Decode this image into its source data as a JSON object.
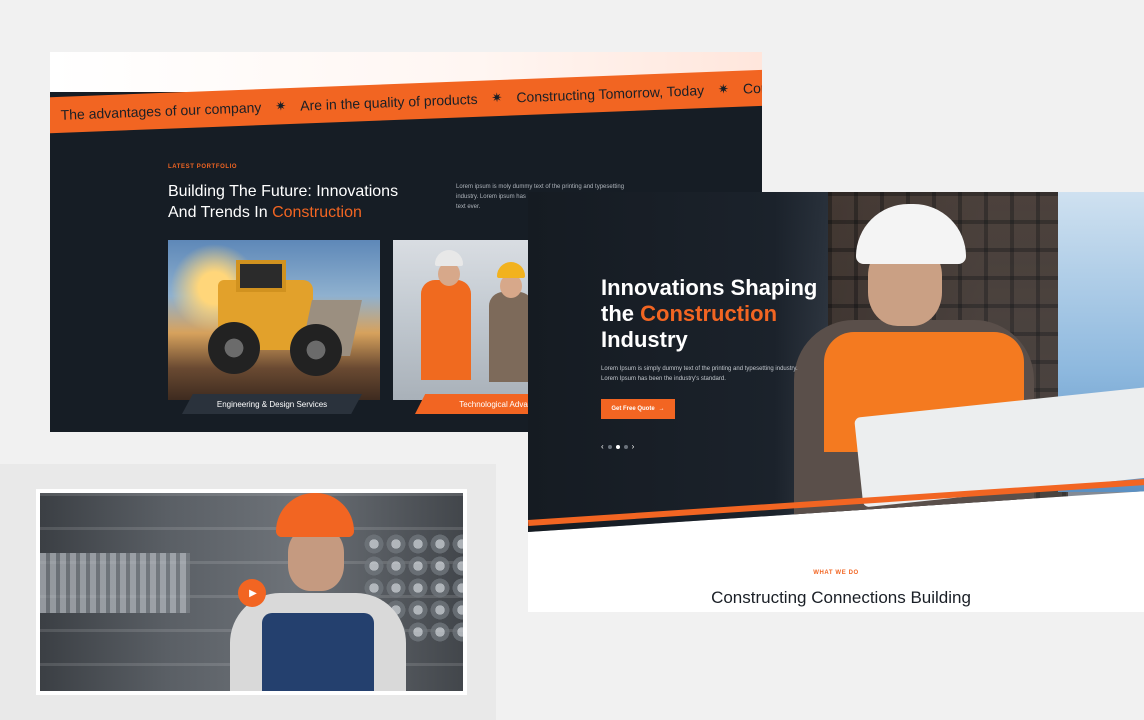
{
  "colors": {
    "accent": "#f26522",
    "dark": "#161d25",
    "page_bg": "#f1f1f1"
  },
  "ticker": {
    "items": [
      "The advantages of our company",
      "Are in the quality of products",
      "Constructing Tomorrow, Today",
      "Constructing"
    ],
    "separator": "✷"
  },
  "portfolio": {
    "label": "LATEST PORTFOLIO",
    "title_line1": "Building The Future: Innovations",
    "title_line2_prefix": "And Trends In ",
    "title_accent": "Construction",
    "description": "Lorem ipsum is moly dummy text of the printing and typesetting industry. Lorem ipsum has",
    "description_tail": "text ever.",
    "items": [
      {
        "caption": "Engineering & Design Services"
      },
      {
        "caption": "Technological Advance"
      }
    ]
  },
  "hero": {
    "title_line1": "Innovations Shaping",
    "title_line2_prefix": "the ",
    "title_accent": "Construction",
    "title_line3": "Industry",
    "description": "Lorem Ipsum is simply dummy text of the printing and typesetting industry. Lorem Ipsum has been the industry's standard.",
    "cta_label": "Get Free Quote",
    "cta_icon": "arrow-right-icon",
    "pager": {
      "prev": "‹",
      "next": "›",
      "count": 3,
      "active": 1
    }
  },
  "what_we_do": {
    "label": "WHAT WE DO",
    "title": "Constructing Connections Building"
  },
  "video": {
    "play_icon": "play-icon"
  }
}
